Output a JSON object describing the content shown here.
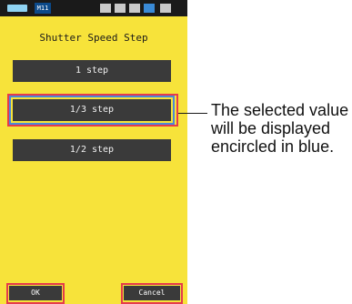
{
  "status_bar": {
    "memory_label": "M11"
  },
  "screen": {
    "title": "Shutter Speed Step",
    "options": [
      {
        "label": "1 step",
        "selected": false
      },
      {
        "label": "1/3 step",
        "selected": true
      },
      {
        "label": "1/2 step",
        "selected": false
      }
    ],
    "ok_label": "OK",
    "cancel_label": "Cancel"
  },
  "annotation": {
    "text": "The selected value will be displayed encircled in blue."
  },
  "colors": {
    "screen_background": "#f7e33a",
    "button_background": "#3a3a3a",
    "selection_outline": "#4a88d8",
    "callout_box": "#e53b4c"
  }
}
